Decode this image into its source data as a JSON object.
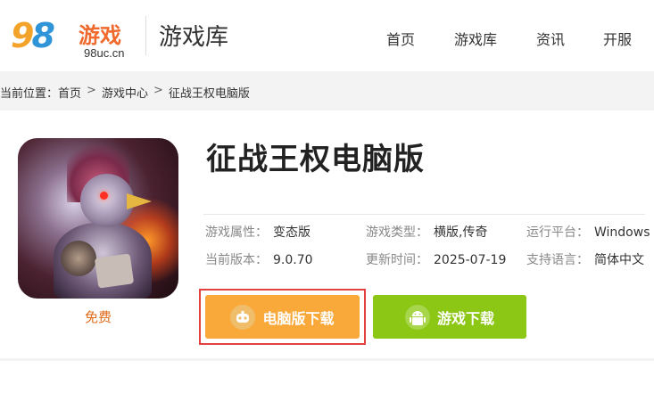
{
  "header": {
    "logo_digits": "98",
    "logo_brand": "游戏",
    "logo_domain": "98uc.cn",
    "section_title": "游戏库",
    "nav": [
      "首页",
      "游戏库",
      "资讯",
      "开服"
    ]
  },
  "breadcrumb": {
    "prefix": "当前位置：",
    "items": [
      "首页",
      "游戏中心",
      "征战王权电脑版"
    ],
    "separator": ">"
  },
  "game": {
    "title": "征战王权电脑版",
    "price_label": "免费",
    "info": [
      {
        "key": "游戏属性：",
        "value": "变态版"
      },
      {
        "key": "游戏类型：",
        "value": "横版,传奇"
      },
      {
        "key": "运行平台：",
        "value": "Windows"
      },
      {
        "key": "当前版本：",
        "value": "9.0.70"
      },
      {
        "key": "更新时间：",
        "value": "2025-07-19"
      },
      {
        "key": "支持语言：",
        "value": "简体中文"
      }
    ],
    "buttons": {
      "pc_download": "电脑版下载",
      "game_download": "游戏下载"
    }
  },
  "colors": {
    "brand_orange": "#ef6a2c",
    "pc_button": "#f8a93a",
    "game_button": "#8cc716",
    "highlight": "#e34040",
    "free_text": "#e06b1c"
  },
  "icons": {
    "pc_button_icon": "gamepad-icon",
    "game_button_icon": "android-icon"
  }
}
